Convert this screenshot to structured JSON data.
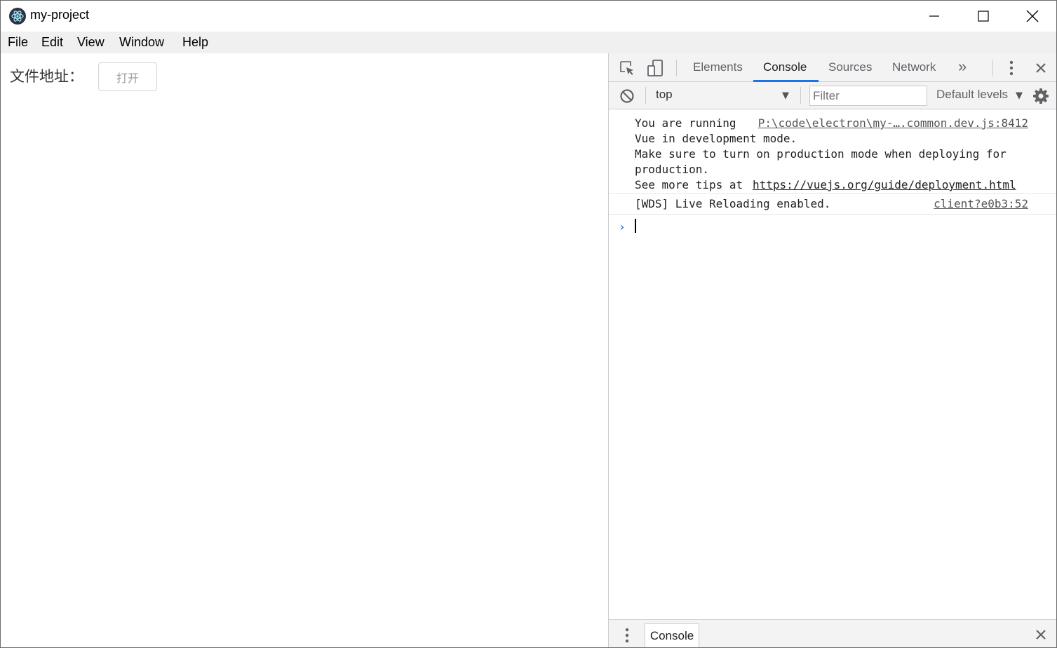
{
  "window": {
    "title": "my-project",
    "icons": {
      "app": "electron-logo-icon",
      "minimize": "minimize-icon",
      "maximize": "maximize-icon",
      "close": "close-icon"
    }
  },
  "menu": {
    "items": [
      "File",
      "Edit",
      "View",
      "Window",
      "Help"
    ]
  },
  "app": {
    "file_label": "文件地址：",
    "open_button": "打开"
  },
  "devtools": {
    "tabs": [
      "Elements",
      "Console",
      "Sources",
      "Network"
    ],
    "active_tab": "Console",
    "more_tabs": "»",
    "accent_color": "#1a73e8",
    "toolbar": {
      "context": "top",
      "filter_placeholder": "Filter",
      "levels": "Default levels"
    },
    "messages": [
      {
        "lines": [
          "You are running",
          "Vue in development mode.",
          "Make sure to turn on production mode when deploying for",
          "production.",
          "See more tips at"
        ],
        "link": "https://vuejs.org/guide/deployment.html",
        "source": "P:\\code\\electron\\my-….common.dev.js:8412"
      },
      {
        "lines": [
          "[WDS] Live Reloading enabled."
        ],
        "source": "client?e0b3:52"
      }
    ],
    "prompt": "›",
    "drawer": {
      "tab": "Console"
    }
  }
}
